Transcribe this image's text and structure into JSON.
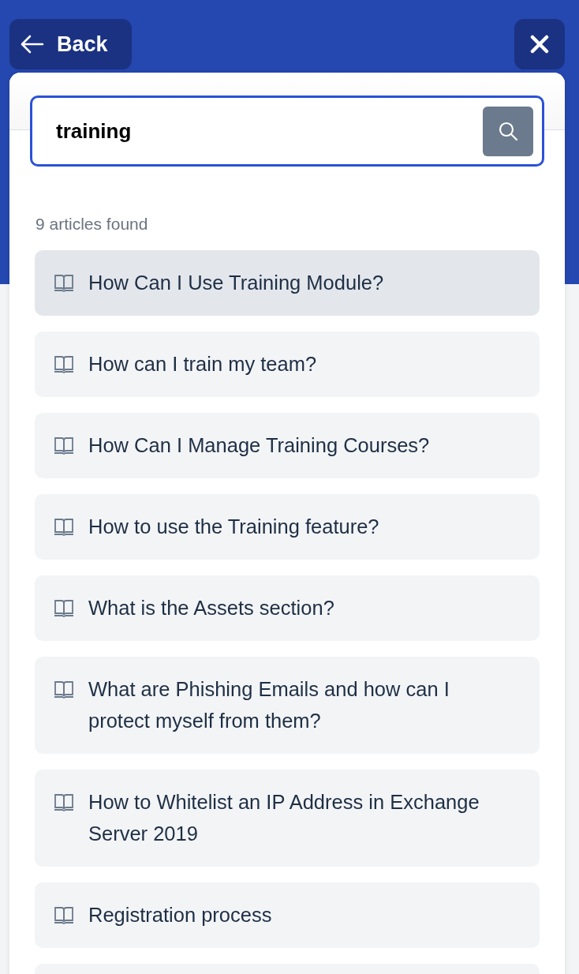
{
  "header": {
    "back_label": "Back"
  },
  "search": {
    "value": "training"
  },
  "result_count": "9 articles found",
  "articles": [
    {
      "title": "How Can I Use Training Module?",
      "selected": true
    },
    {
      "title": "How can I train my team?",
      "selected": false
    },
    {
      "title": "How Can I Manage Training Courses?",
      "selected": false
    },
    {
      "title": "How to use the Training feature?",
      "selected": false
    },
    {
      "title": "What is the Assets section?",
      "selected": false
    },
    {
      "title": "What are Phishing Emails and how can I protect myself from them?",
      "selected": false
    },
    {
      "title": "How to Whitelist an IP Address in Exchange Server 2019",
      "selected": false
    },
    {
      "title": "Registration process",
      "selected": false
    },
    {
      "selected": false
    }
  ]
}
